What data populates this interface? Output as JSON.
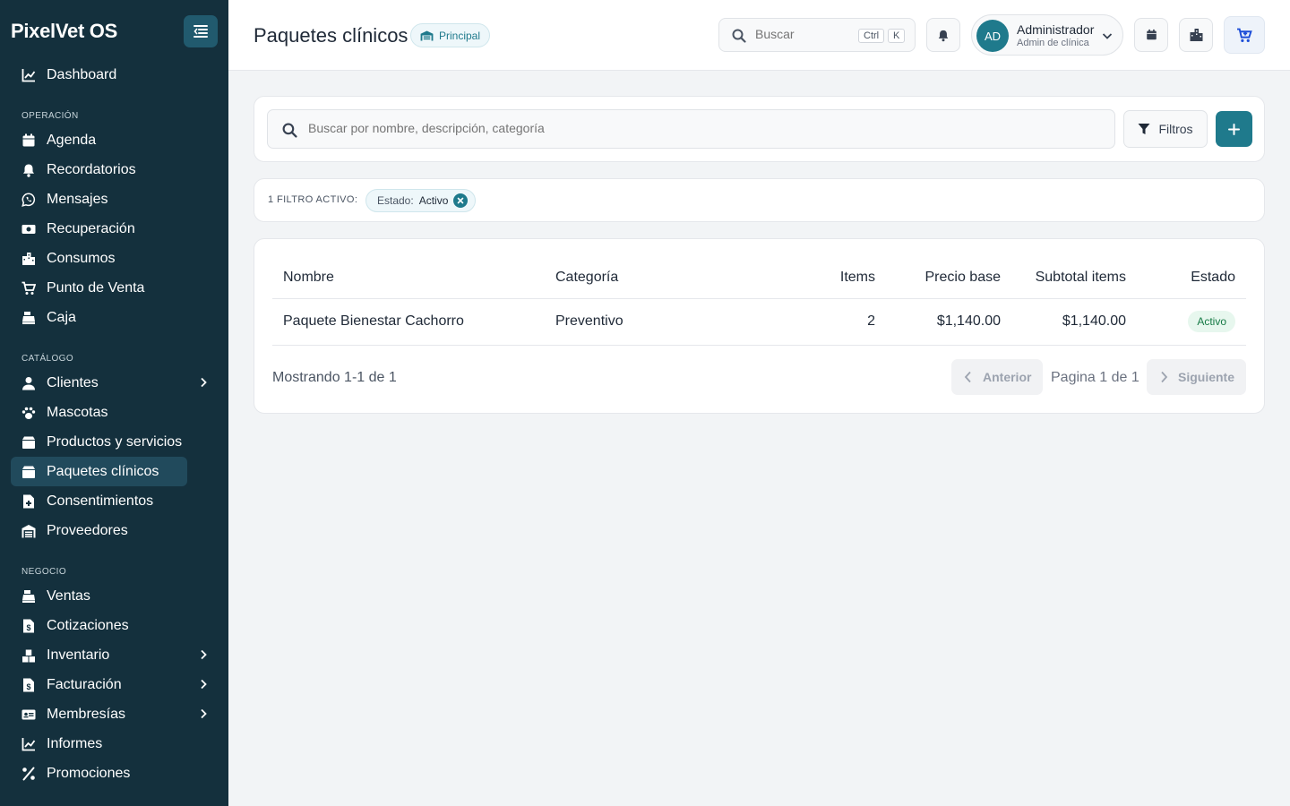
{
  "app": {
    "brand": "PixelVet OS"
  },
  "sidebar": {
    "top_items": [
      {
        "label": "Dashboard",
        "icon": "chart-line-icon"
      }
    ],
    "sections": [
      {
        "title": "Operación",
        "items": [
          {
            "label": "Agenda",
            "icon": "calendar-icon"
          },
          {
            "label": "Recordatorios",
            "icon": "bell-icon"
          },
          {
            "label": "Mensajes",
            "icon": "whatsapp-icon"
          },
          {
            "label": "Recuperación",
            "icon": "money-bill-icon"
          },
          {
            "label": "Consumos",
            "icon": "building-icon"
          },
          {
            "label": "Punto de Venta",
            "icon": "cart-icon"
          },
          {
            "label": "Caja",
            "icon": "cash-register-icon"
          }
        ]
      },
      {
        "title": "Catálogo",
        "items": [
          {
            "label": "Clientes",
            "icon": "user-icon",
            "has_children": true
          },
          {
            "label": "Mascotas",
            "icon": "paw-icon"
          },
          {
            "label": "Productos y servicios",
            "icon": "box-icon"
          },
          {
            "label": "Paquetes clínicos",
            "icon": "package-icon",
            "active": true
          },
          {
            "label": "Consentimientos",
            "icon": "file-medical-icon"
          },
          {
            "label": "Proveedores",
            "icon": "warehouse-icon"
          }
        ]
      },
      {
        "title": "Negocio",
        "items": [
          {
            "label": "Ventas",
            "icon": "cash-register-icon"
          },
          {
            "label": "Cotizaciones",
            "icon": "file-invoice-icon"
          },
          {
            "label": "Inventario",
            "icon": "boxes-icon",
            "has_children": true
          },
          {
            "label": "Facturación",
            "icon": "file-invoice-icon",
            "has_children": true
          },
          {
            "label": "Membresías",
            "icon": "id-card-icon",
            "has_children": true
          },
          {
            "label": "Informes",
            "icon": "chart-line-icon"
          },
          {
            "label": "Promociones",
            "icon": "percent-icon"
          }
        ]
      }
    ]
  },
  "header": {
    "title": "Paquetes clínicos",
    "branch_badge": "Principal",
    "search_placeholder": "Buscar",
    "shortcut_keys": [
      "Ctrl",
      "K"
    ],
    "user": {
      "initials": "AD",
      "name": "Administrador",
      "role": "Admin de clínica"
    }
  },
  "search": {
    "placeholder": "Buscar por nombre, descripción, categoría",
    "filters_label": "Filtros"
  },
  "active_filters": {
    "count_label": "1 filtro activo:",
    "chips": [
      {
        "key": "Estado:",
        "value": "Activo"
      }
    ]
  },
  "table": {
    "columns": [
      "Nombre",
      "Categoría",
      "Items",
      "Precio base",
      "Subtotal items",
      "Estado"
    ],
    "rows": [
      {
        "nombre": "Paquete Bienestar Cachorro",
        "categoria": "Preventivo",
        "items": "2",
        "precio_base": "$1,140.00",
        "subtotal_items": "$1,140.00",
        "estado": "Activo"
      }
    ]
  },
  "pagination": {
    "showing": "Mostrando 1-1 de 1",
    "prev_label": "Anterior",
    "page_label": "Pagina 1 de 1",
    "next_label": "Siguiente"
  },
  "colors": {
    "sidebar_bg": "#14303d",
    "accent": "#1f7a8c",
    "active_status": "#167a45"
  }
}
